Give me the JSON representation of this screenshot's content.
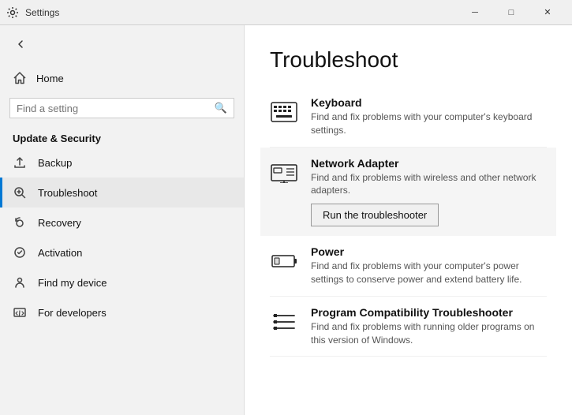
{
  "titleBar": {
    "title": "Settings",
    "minLabel": "─",
    "maxLabel": "□",
    "closeLabel": "✕"
  },
  "sidebar": {
    "backArrow": "←",
    "homeLabel": "Home",
    "searchPlaceholder": "Find a setting",
    "searchIcon": "🔍",
    "sectionTitle": "Update & Security",
    "items": [
      {
        "id": "backup",
        "label": "Backup",
        "icon": "backup"
      },
      {
        "id": "troubleshoot",
        "label": "Troubleshoot",
        "icon": "wrench",
        "active": true
      },
      {
        "id": "recovery",
        "label": "Recovery",
        "icon": "recovery"
      },
      {
        "id": "activation",
        "label": "Activation",
        "icon": "activation"
      },
      {
        "id": "find-my-device",
        "label": "Find my device",
        "icon": "person"
      },
      {
        "id": "for-developers",
        "label": "For developers",
        "icon": "developers"
      }
    ]
  },
  "main": {
    "pageTitle": "Troubleshoot",
    "items": [
      {
        "id": "keyboard",
        "title": "Keyboard",
        "desc": "Find and fix problems with your computer's keyboard settings.",
        "icon": "keyboard"
      },
      {
        "id": "network-adapter",
        "title": "Network Adapter",
        "desc": "Find and fix problems with wireless and other network adapters.",
        "icon": "network",
        "highlighted": true,
        "runBtn": "Run the troubleshooter"
      },
      {
        "id": "power",
        "title": "Power",
        "desc": "Find and fix problems with your computer's power settings to conserve power and extend battery life.",
        "icon": "power"
      },
      {
        "id": "program-compat",
        "title": "Program Compatibility Troubleshooter",
        "desc": "Find and fix problems with running older programs on this version of Windows.",
        "icon": "list"
      }
    ]
  }
}
